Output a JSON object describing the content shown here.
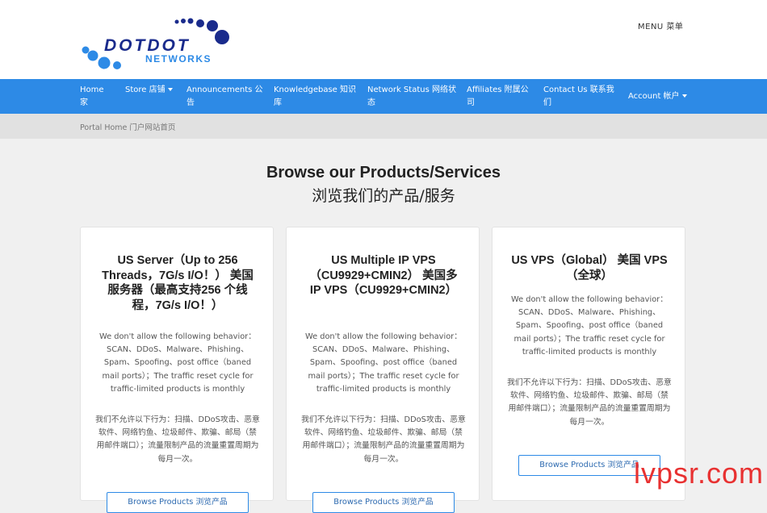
{
  "header": {
    "menu_label": "MENU  菜单"
  },
  "logo": {
    "brand": "DOTDOT",
    "sub": "NETWORKS",
    "color_primary": "#1a2b8c",
    "color_accent": "#2d8ae6"
  },
  "nav": {
    "items": [
      {
        "label": "Home  家",
        "has_caret": false
      },
      {
        "label": "Store  店铺",
        "has_caret": true
      },
      {
        "label": "Announcements  公告",
        "has_caret": false
      },
      {
        "label": "Knowledgebase  知识库",
        "has_caret": false
      },
      {
        "label": "Network Status  网络状态",
        "has_caret": false
      },
      {
        "label": "Affiliates  附属公司",
        "has_caret": false
      },
      {
        "label": "Contact Us  联系我们",
        "has_caret": false
      }
    ],
    "account": "Account  帐户",
    "bg_color": "#2d8ae6"
  },
  "breadcrumb": {
    "text": "Portal Home  门户网站首页"
  },
  "page": {
    "title_en": "Browse our Products/Services",
    "title_zh": "浏览我们的产品/服务"
  },
  "cards": [
    {
      "title": "US Server（Up to 256 Threads，7G/s I/O！） 美国服务器（最高支持256 个线程，7G/s I/O！）",
      "desc_en": "We don't allow the following behavior：SCAN、DDoS、Malware、Phishing、Spam、Spoofing、post office（baned mail ports）；The traffic reset cycle for traffic-limited products is monthly",
      "desc_zh": "我们不允许以下行为：扫描、DDoS攻击、恶意软件、网络钓鱼、垃圾邮件、欺骗、邮局（禁用邮件端口）；流量限制产品的流量重置周期为每月一次。",
      "button": "Browse Products  浏览产品"
    },
    {
      "title": "US Multiple IP VPS（CU9929+CMIN2） 美国多 IP VPS（CU9929+CMIN2）",
      "desc_en": "We don't allow the following behavior：SCAN、DDoS、Malware、Phishing、Spam、Spoofing、post office（baned mail ports）；The traffic reset cycle for traffic-limited products is monthly",
      "desc_zh": "我们不允许以下行为：扫描、DDoS攻击、恶意软件、网络钓鱼、垃圾邮件、欺骗、邮局（禁用邮件端口）；流量限制产品的流量重置周期为每月一次。",
      "button": "Browse Products  浏览产品"
    },
    {
      "title": "US VPS（Global） 美国 VPS（全球）",
      "desc_en": "We don't allow the following behavior：SCAN、DDoS、Malware、Phishing、Spam、Spoofing、post office（baned mail ports）；The traffic reset cycle for traffic-limited products is monthly",
      "desc_zh": "我们不允许以下行为：扫描、DDoS攻击、恶意软件、网络钓鱼、垃圾邮件、欺骗、邮局（禁用邮件端口）；流量限制产品的流量重置周期为每月一次。",
      "button": "Browse Products  浏览产品"
    }
  ],
  "watermark": {
    "text": "lvpsr.com",
    "color": "#e83131"
  }
}
